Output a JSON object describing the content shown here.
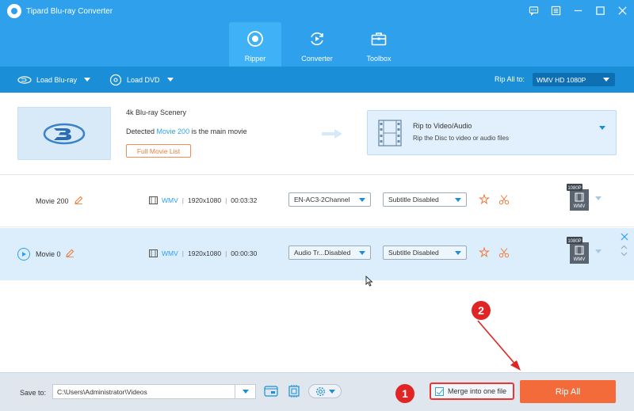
{
  "app": {
    "title": "Tipard Blu-ray Converter"
  },
  "nav": {
    "tabs": [
      {
        "label": "Ripper",
        "icon": "ripper-icon",
        "active": true
      },
      {
        "label": "Converter",
        "icon": "converter-icon",
        "active": false
      },
      {
        "label": "Toolbox",
        "icon": "toolbox-icon",
        "active": false
      }
    ]
  },
  "toolbar": {
    "load_bluray": "Load Blu-ray",
    "load_dvd": "Load DVD",
    "rip_all_to_label": "Rip All to:",
    "rip_all_format": "WMV HD 1080P"
  },
  "source": {
    "title": "4k Blu-ray Scenery",
    "detected_prefix": "Detected",
    "detected_movie": "Movie 200",
    "detected_suffix": "is the main movie",
    "full_list_button": "Full Movie List",
    "rip_to_title": "Rip to Video/Audio",
    "rip_to_subtitle": "Rip the Disc to video or audio files"
  },
  "movies": [
    {
      "name": "Movie 200",
      "format": "WMV",
      "resolution": "1920x1080",
      "duration": "00:03:32",
      "audio": "EN-AC3-2Channel",
      "subtitle": "Subtitle Disabled",
      "output_badge_top": "1080P",
      "output_badge_bottom": "WMV"
    },
    {
      "name": "Movie 0",
      "format": "WMV",
      "resolution": "1920x1080",
      "duration": "00:00:30",
      "audio": "Audio Tr...Disabled",
      "subtitle": "Subtitle Disabled",
      "output_badge_top": "1080P",
      "output_badge_bottom": "WMV"
    }
  ],
  "footer": {
    "save_to_label": "Save to:",
    "save_path": "C:\\Users\\Administrator\\Videos",
    "merge_label": "Merge into one file",
    "merge_checked": true,
    "rip_all_button": "Rip All"
  },
  "annotations": {
    "badge1": "1",
    "badge2": "2",
    "color": "#e02525"
  },
  "colors": {
    "accent": "#2ea0ec",
    "toolbar": "#1a8fd8",
    "rip_button": "#f36b3a"
  }
}
